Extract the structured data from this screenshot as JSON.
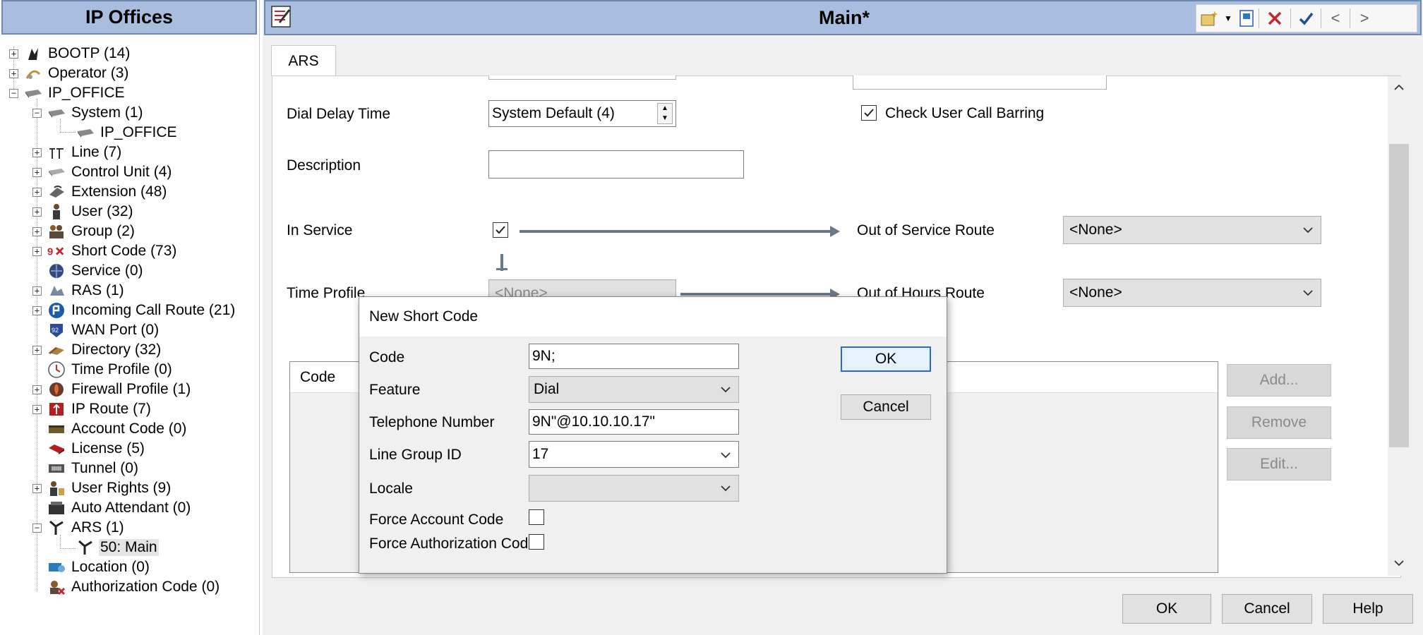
{
  "left_panel": {
    "title": "IP Offices",
    "tree": [
      {
        "label": "BOOTP (14)",
        "icon": "bootp-icon"
      },
      {
        "label": "Operator (3)",
        "icon": "operator-icon"
      },
      {
        "label": "IP_OFFICE",
        "icon": "ip-office-icon"
      },
      {
        "label": "System (1)",
        "icon": "system-icon"
      },
      {
        "label": "IP_OFFICE",
        "icon": "system-node-icon"
      },
      {
        "label": "Line (7)",
        "icon": "line-icon"
      },
      {
        "label": "Control Unit (4)",
        "icon": "control-unit-icon"
      },
      {
        "label": "Extension (48)",
        "icon": "extension-icon"
      },
      {
        "label": "User (32)",
        "icon": "user-icon"
      },
      {
        "label": "Group (2)",
        "icon": "group-icon"
      },
      {
        "label": "Short Code (73)",
        "icon": "short-code-icon"
      },
      {
        "label": "Service (0)",
        "icon": "service-icon"
      },
      {
        "label": "RAS (1)",
        "icon": "ras-icon"
      },
      {
        "label": "Incoming Call Route (21)",
        "icon": "incoming-call-route-icon"
      },
      {
        "label": "WAN Port (0)",
        "icon": "wan-port-icon"
      },
      {
        "label": "Directory (32)",
        "icon": "directory-icon"
      },
      {
        "label": "Time Profile (0)",
        "icon": "time-profile-icon"
      },
      {
        "label": "Firewall Profile (1)",
        "icon": "firewall-profile-icon"
      },
      {
        "label": "IP Route (7)",
        "icon": "ip-route-icon"
      },
      {
        "label": "Account Code (0)",
        "icon": "account-code-icon"
      },
      {
        "label": "License (5)",
        "icon": "license-icon"
      },
      {
        "label": "Tunnel (0)",
        "icon": "tunnel-icon"
      },
      {
        "label": "User Rights (9)",
        "icon": "user-rights-icon"
      },
      {
        "label": "Auto Attendant (0)",
        "icon": "auto-attendant-icon"
      },
      {
        "label": "ARS (1)",
        "icon": "ars-icon"
      },
      {
        "label": "50: Main",
        "icon": "ars-entry-icon"
      },
      {
        "label": "Location (0)",
        "icon": "location-icon"
      },
      {
        "label": "Authorization Code (0)",
        "icon": "authorization-code-icon"
      }
    ]
  },
  "header": {
    "title": "Main*",
    "toolbar": {
      "new_icon": "new-record-icon",
      "dropdown_icon": "dropdown-arrow-icon",
      "export_icon": "export-icon",
      "delete_icon": "delete-icon",
      "validate_icon": "validate-checkmark-icon",
      "previous_label": "<",
      "next_label": ">"
    }
  },
  "tabs": [
    {
      "label": "ARS",
      "active": true
    }
  ],
  "form": {
    "dial_delay_time_label": "Dial Delay Time",
    "dial_delay_time_value": "System Default (4)",
    "check_user_call_barring_label": "Check User Call Barring",
    "check_user_call_barring_checked": true,
    "description_label": "Description",
    "description_value": "",
    "in_service_label": "In Service",
    "in_service_checked": true,
    "out_of_service_route_label": "Out of Service Route",
    "out_of_service_route_value": "<None>",
    "time_profile_label": "Time Profile",
    "time_profile_value": "<None>",
    "out_of_hours_route_label": "Out of Hours Route",
    "out_of_hours_route_value": "<None>",
    "table_code_header": "Code",
    "add_button": "Add...",
    "remove_button": "Remove",
    "edit_button": "Edit..."
  },
  "footer": {
    "ok": "OK",
    "cancel": "Cancel",
    "help": "Help"
  },
  "dialog": {
    "title": "New Short Code",
    "code_label": "Code",
    "code_value": "9N;",
    "feature_label": "Feature",
    "feature_value": "Dial",
    "telephone_number_label": "Telephone Number",
    "telephone_number_value": "9N\"@10.10.10.17\"",
    "line_group_id_label": "Line Group ID",
    "line_group_id_value": "17",
    "locale_label": "Locale",
    "locale_value": "",
    "force_account_code_label": "Force Account Code",
    "force_account_code_checked": false,
    "force_authorization_code_label": "Force Authorization Code",
    "force_authorization_code_checked": false,
    "ok_button": "OK",
    "cancel_button": "Cancel"
  },
  "colors": {
    "header_bg": "#a9bede",
    "header_border": "#6e87ad",
    "button_bg": "#e1e1e1",
    "dialog_bg": "#f0f0f0",
    "delete_red": "#c0282d",
    "validate_blue": "#1f4e9a"
  }
}
